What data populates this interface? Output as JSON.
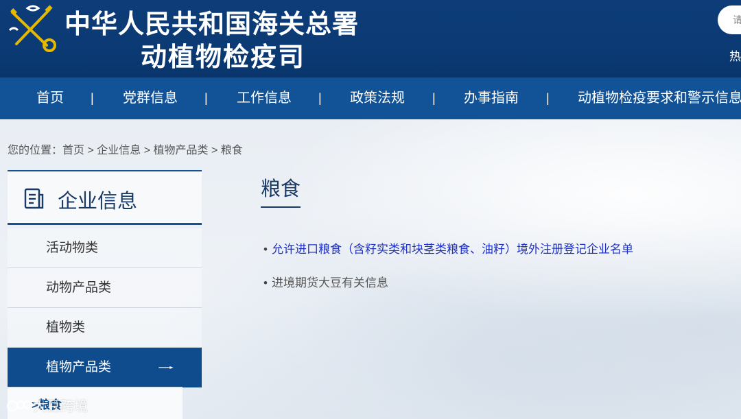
{
  "header": {
    "title": "中华人民共和国海关总署",
    "subtitle": "动植物检疫司",
    "search_placeholder": "请",
    "hot_label": "热"
  },
  "nav": {
    "items": [
      {
        "label": "首页"
      },
      {
        "label": "党群信息"
      },
      {
        "label": "工作信息"
      },
      {
        "label": "政策法规"
      },
      {
        "label": "办事指南"
      },
      {
        "label": "动植物检疫要求和警示信息"
      }
    ],
    "separator": "|"
  },
  "breadcrumb": {
    "prefix": "您的位置：",
    "items": [
      "首页",
      "企业信息",
      "植物产品类",
      "粮食"
    ],
    "separator": " > "
  },
  "sidebar": {
    "title": "企业信息",
    "items": [
      {
        "label": "活动物类",
        "active": false
      },
      {
        "label": "动物产品类",
        "active": false
      },
      {
        "label": "植物类",
        "active": false
      },
      {
        "label": "植物产品类",
        "active": true
      }
    ],
    "sub_item": ">粮食"
  },
  "main": {
    "title": "粮食",
    "list": [
      {
        "text": "允许进口粮食（含籽实类和块茎类粮食、油籽）境外注册登记企业名单",
        "is_link": true
      },
      {
        "text": "进境期货大豆有关信息",
        "is_link": false
      }
    ]
  },
  "watermark": {
    "text": "大豆跨境"
  },
  "colors": {
    "header_bg": "#0b3a74",
    "nav_bg": "#125297",
    "active_bg": "#0f4c8d",
    "link": "#1f32c4"
  }
}
